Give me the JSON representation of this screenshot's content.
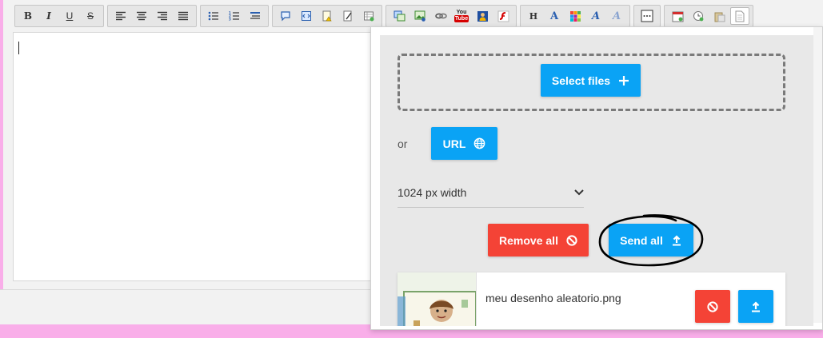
{
  "toolbar": {
    "groups": [
      [
        {
          "icon": "bold-icon",
          "glyph": "B"
        },
        {
          "icon": "italic-icon",
          "glyph": "I"
        },
        {
          "icon": "underline-icon",
          "glyph": "U"
        },
        {
          "icon": "strikethrough-icon",
          "glyph": "S"
        }
      ],
      [
        {
          "icon": "align-left-icon",
          "glyph": ""
        },
        {
          "icon": "align-center-icon",
          "glyph": ""
        },
        {
          "icon": "align-right-icon",
          "glyph": ""
        },
        {
          "icon": "align-justify-icon",
          "glyph": ""
        }
      ],
      [
        {
          "icon": "bullet-list-icon",
          "glyph": ""
        },
        {
          "icon": "numbered-list-icon",
          "glyph": ""
        },
        {
          "icon": "indent-icon",
          "glyph": ""
        }
      ],
      [
        {
          "icon": "speech-bubble-icon",
          "glyph": ""
        },
        {
          "icon": "code-icon",
          "glyph": ""
        },
        {
          "icon": "note-warning-icon",
          "glyph": ""
        },
        {
          "icon": "note-edit-icon",
          "glyph": ""
        },
        {
          "icon": "table-icon",
          "glyph": ""
        }
      ],
      [
        {
          "icon": "image-gallery-icon",
          "glyph": ""
        },
        {
          "icon": "insert-image-icon",
          "glyph": ""
        },
        {
          "icon": "link-icon",
          "glyph": ""
        },
        {
          "icon": "youtube-icon",
          "glyph": "You Tube"
        },
        {
          "icon": "user-upload-icon",
          "glyph": ""
        },
        {
          "icon": "flash-icon",
          "glyph": ""
        }
      ],
      [
        {
          "icon": "heading-icon",
          "glyph": "H"
        },
        {
          "icon": "font-style-icon",
          "glyph": "A"
        },
        {
          "icon": "color-grid-icon",
          "glyph": ""
        },
        {
          "icon": "font-italic-icon",
          "glyph": "A"
        },
        {
          "icon": "clear-format-icon",
          "glyph": "A"
        }
      ],
      [
        {
          "icon": "more-dots-icon",
          "glyph": "⋯"
        }
      ],
      [
        {
          "icon": "calendar-icon",
          "glyph": ""
        },
        {
          "icon": "clock-search-icon",
          "glyph": ""
        },
        {
          "icon": "paste-icon",
          "glyph": ""
        },
        {
          "icon": "document-icon",
          "glyph": ""
        }
      ]
    ]
  },
  "upload": {
    "select_files_label": "Select files",
    "or_label": "or",
    "url_label": "URL",
    "width_option": "1024 px width",
    "remove_all_label": "Remove all",
    "send_all_label": "Send all",
    "file": {
      "name": "meu desenho aleatorio.png"
    }
  },
  "colors": {
    "accent_blue": "#0aa3f5",
    "danger_red": "#f44336",
    "page_pink": "#f9aee9"
  }
}
